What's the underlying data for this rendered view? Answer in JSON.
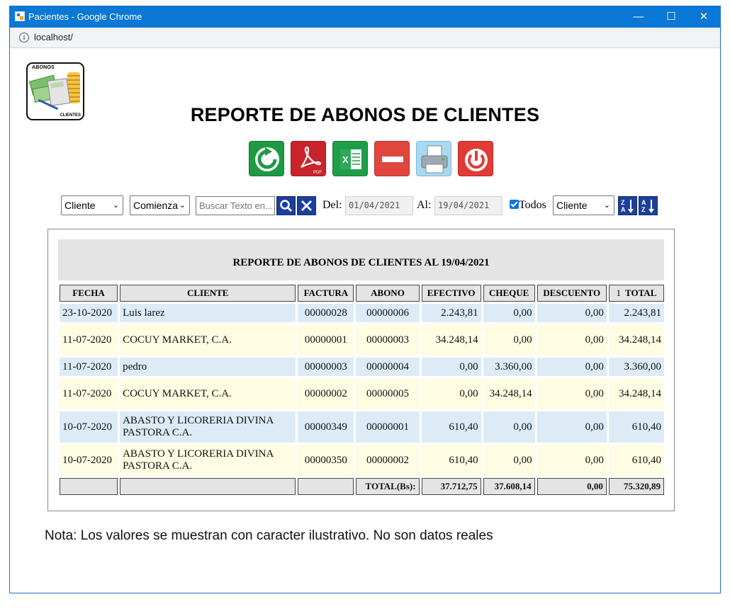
{
  "window": {
    "title": "Pacientes - Google Chrome",
    "controls": {
      "minimize": "—",
      "maximize": "☐",
      "close": "✕"
    }
  },
  "address_bar": {
    "url": "localhost/"
  },
  "logo": {
    "top_text": "ABONOS",
    "bottom_text": "CLIENTES"
  },
  "page_title": "REPORTE DE ABONOS DE CLIENTES",
  "toolbar": {
    "buttons": [
      {
        "name": "refresh",
        "icon": "refresh-icon",
        "color": "#1d9a43"
      },
      {
        "name": "pdf",
        "icon": "pdf-icon",
        "color": "#c9242b",
        "text": "PDF"
      },
      {
        "name": "excel",
        "icon": "excel-icon",
        "color": "#1f9e48"
      },
      {
        "name": "remove",
        "icon": "minus-icon",
        "color": "#e0463b"
      },
      {
        "name": "print",
        "icon": "printer-icon",
        "color": "#a9d9f0"
      },
      {
        "name": "exit",
        "icon": "power-icon",
        "color": "#e23b36"
      }
    ]
  },
  "filters": {
    "field_select": "Cliente",
    "match_select": "Comienza",
    "search_placeholder": "Buscar Texto en...",
    "from_label": "Del:",
    "from_date": "01/04/2021",
    "to_label": "Al:",
    "to_date": "19/04/2021",
    "todos_label": "Todos",
    "todos_checked": true,
    "order_select": "Cliente"
  },
  "report": {
    "title": "REPORTE DE ABONOS DE CLIENTES AL 19/04/2021",
    "columns": [
      "FECHA",
      "CLIENTE",
      "FACTURA",
      "ABONO",
      "EFECTIVO",
      "CHEQUE",
      "DESCUENTO",
      "TOTAL"
    ],
    "total_column_prefix": "1",
    "rows": [
      {
        "fecha": "23-10-2020",
        "cliente": "Luis larez",
        "factura": "00000028",
        "abono": "00000006",
        "efectivo": "2.243,81",
        "cheque": "0,00",
        "descuento": "0,00",
        "total": "2.243,81"
      },
      {
        "fecha": "11-07-2020",
        "cliente": "COCUY MARKET, C.A.",
        "factura": "00000001",
        "abono": "00000003",
        "efectivo": "34.248,14",
        "cheque": "0,00",
        "descuento": "0,00",
        "total": "34.248,14"
      },
      {
        "fecha": "11-07-2020",
        "cliente": "pedro",
        "factura": "00000003",
        "abono": "00000004",
        "efectivo": "0,00",
        "cheque": "3.360,00",
        "descuento": "0,00",
        "total": "3.360,00"
      },
      {
        "fecha": "11-07-2020",
        "cliente": "COCUY MARKET, C.A.",
        "factura": "00000002",
        "abono": "00000005",
        "efectivo": "0,00",
        "cheque": "34.248,14",
        "descuento": "0,00",
        "total": "34.248,14"
      },
      {
        "fecha": "10-07-2020",
        "cliente": "ABASTO Y LICORERIA DIVINA PASTORA C.A.",
        "factura": "00000349",
        "abono": "00000001",
        "efectivo": "610,40",
        "cheque": "0,00",
        "descuento": "0,00",
        "total": "610,40"
      },
      {
        "fecha": "10-07-2020",
        "cliente": "ABASTO Y LICORERIA DIVINA PASTORA C.A.",
        "factura": "00000350",
        "abono": "00000002",
        "efectivo": "610,40",
        "cheque": "0,00",
        "descuento": "0,00",
        "total": "610,40"
      }
    ],
    "totals": {
      "label": "TOTAL(Bs):",
      "efectivo": "37.712,75",
      "cheque": "37.608,14",
      "descuento": "0,00",
      "total": "75.320,89"
    }
  },
  "nota": "Nota: Los valores se muestran con caracter ilustrativo. No son datos reales",
  "colors": {
    "titlebar": "#0a78d4",
    "row_blue": "#dcebf6",
    "row_yellow": "#fefde3",
    "header_gray": "#e4e4e4",
    "button_navy": "#1c3f9c"
  }
}
